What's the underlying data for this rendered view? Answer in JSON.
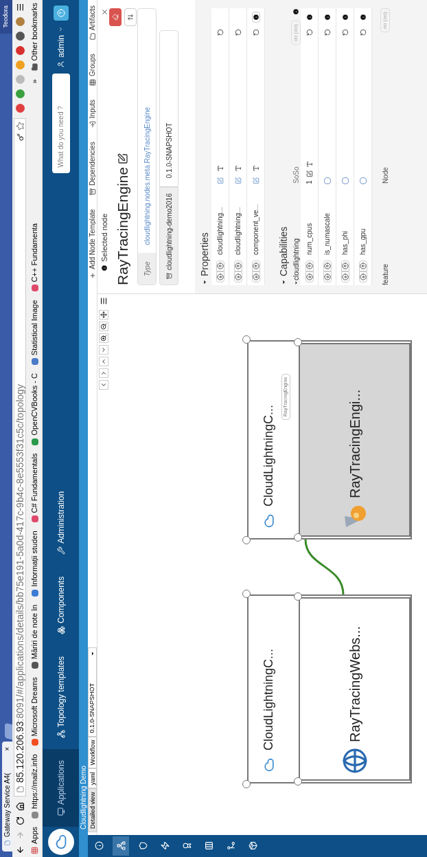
{
  "browser": {
    "tab_title": "Gateway Service A4(",
    "tab_close": "×",
    "user": "Teodora",
    "url_host": "85.120.206.93",
    "url_rest": ":8091/#/applications/details/bb75e191-5a0d-417c-9b4c-8e5553f31c5c/topology"
  },
  "bookmarks": [
    {
      "label": "Apps"
    },
    {
      "label": "https://mailz.info"
    },
    {
      "label": "Microsoft Dreams"
    },
    {
      "label": "Măriri de note în"
    },
    {
      "label": "Informații studen"
    },
    {
      "label": "C# Fundamentals"
    },
    {
      "label": "OpenCVBooks - C"
    },
    {
      "label": "Statistical Image"
    },
    {
      "label": "C++ Fundamenta"
    }
  ],
  "bookmarks_more": "»",
  "other_bookmarks": "Other bookmarks",
  "navbar": {
    "items": [
      {
        "label": "Applications",
        "selected": true
      },
      {
        "label": "Topology templates",
        "selected": false
      },
      {
        "label": "Components",
        "selected": false
      },
      {
        "label": "Administration",
        "selected": false
      }
    ],
    "search_placeholder": "What do you need ?",
    "user": "admin"
  },
  "breadcrumb": "Cloudlightning Demo",
  "sidebar": {
    "items": [
      {
        "selected": false
      },
      {
        "selected": true
      },
      {
        "selected": false
      },
      {
        "selected": false
      },
      {
        "selected": false
      },
      {
        "selected": false
      },
      {
        "selected": false
      },
      {
        "selected": false
      }
    ]
  },
  "view_tabs": [
    {
      "label": "Detailed view",
      "selected": true
    },
    {
      "label": "yaml",
      "selected": false
    },
    {
      "label": "Workflow",
      "selected": false
    }
  ],
  "version_select": "0.1.0-SNAPSHOT",
  "panel_tabs": [
    "Add Node Template",
    "Dependencies",
    "Inputs",
    "Groups",
    "Artifacts"
  ],
  "canvas": {
    "nodes": [
      {
        "title": "CloudLightningC...",
        "child": "RayTracingWebs...",
        "kind": "web",
        "selected": false
      },
      {
        "title": "CloudLightningC...",
        "child": "RayTracingEngi...",
        "kind": "engine",
        "selected": true,
        "requirement_label": "RayTracingEngine"
      }
    ]
  },
  "selected_node": {
    "header": "Selected node",
    "name": "RayTracingEngine",
    "type_label": "Type",
    "type": "cloudlightning.nodes.meta.RayTracingEngine",
    "archive": "cloudlightning-demo2016",
    "version": "0.1.0-SNAPSHOT",
    "properties_title": "Properties",
    "properties": [
      {
        "name": "cloudlightning...",
        "info": false
      },
      {
        "name": "cloudlightning...",
        "info": false
      },
      {
        "name": "component_ve...",
        "info": true
      }
    ],
    "capabilities_title": "Capabilities",
    "capability": {
      "name": "cloudlightning",
      "type": "SoSo",
      "occurrences": "oo (oo)"
    },
    "capability_rows": [
      {
        "kind": "text",
        "name": "num_cpus",
        "value": "1"
      },
      {
        "kind": "checkbox",
        "name": "is_numascale",
        "checked": false
      },
      {
        "kind": "checkbox",
        "name": "has_phi",
        "checked": false
      },
      {
        "kind": "checkbox",
        "name": "has_gpu",
        "checked": false
      }
    ],
    "footer": {
      "name": "feature",
      "type": "Node",
      "occurrences": "oo (oo)"
    }
  }
}
